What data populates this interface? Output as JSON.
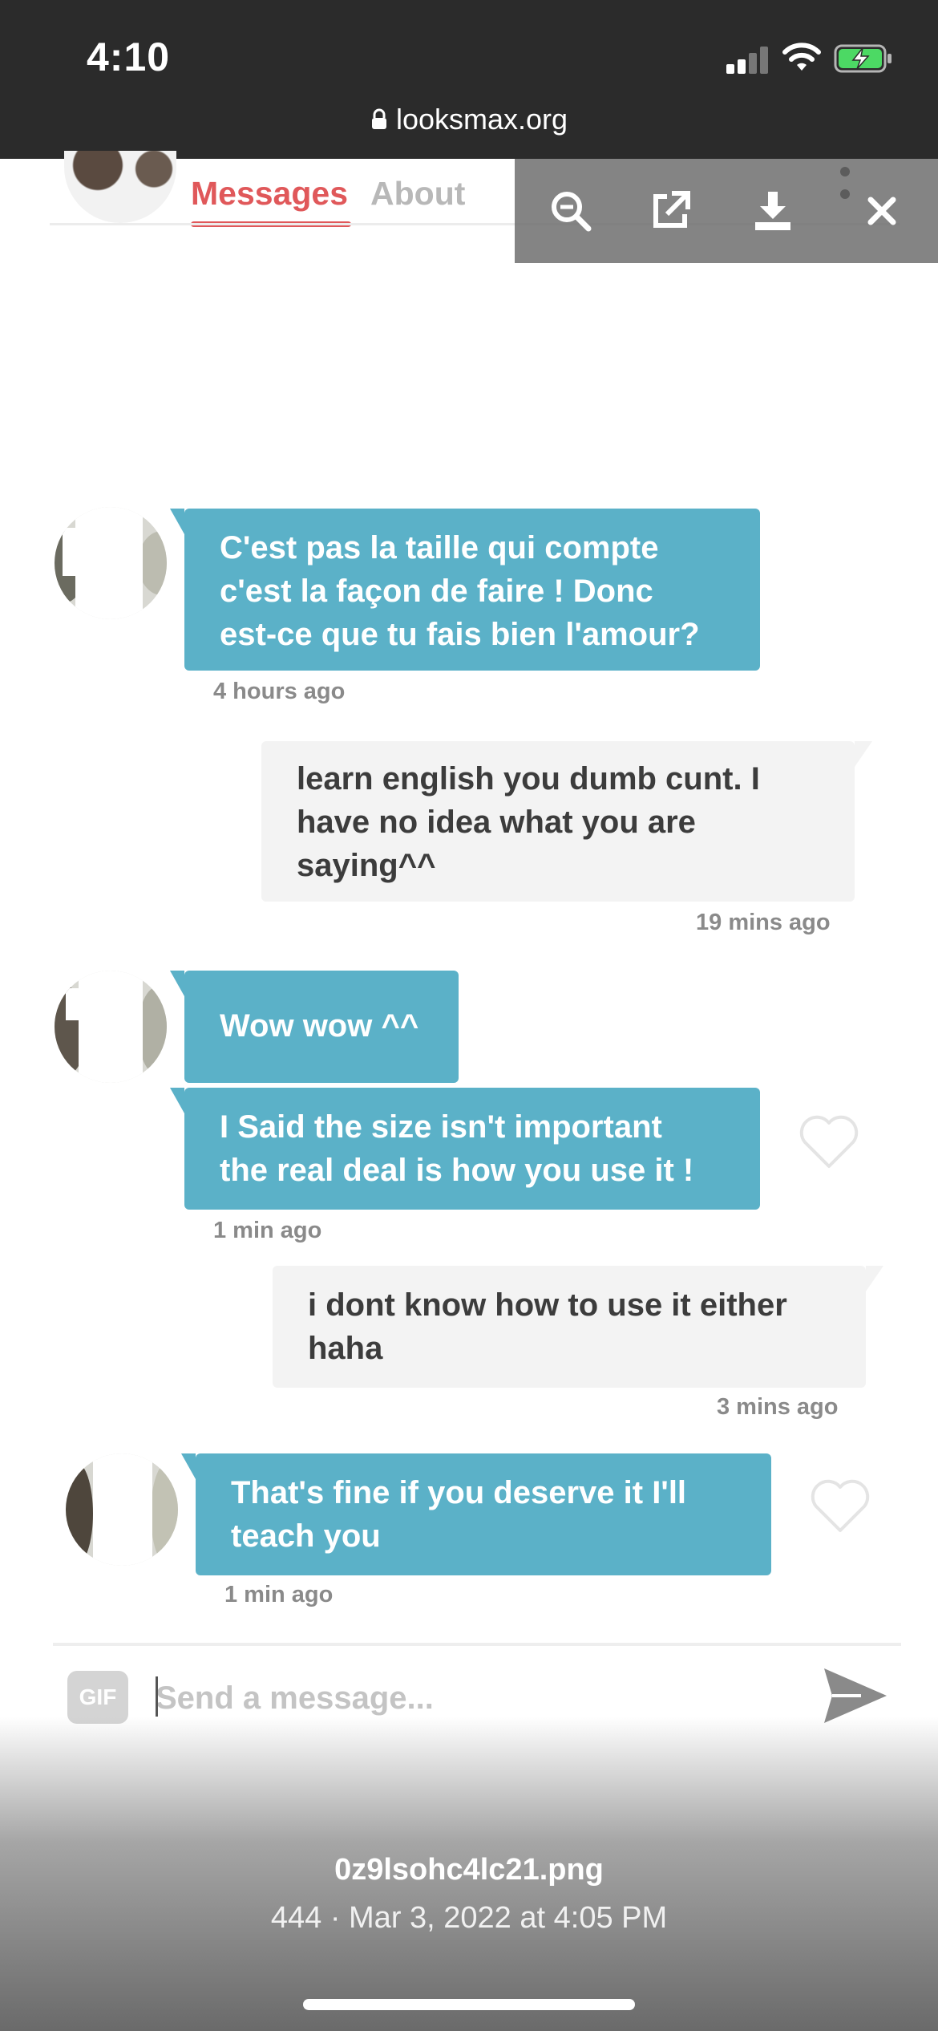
{
  "status_bar": {
    "time": "4:10",
    "icons": [
      "signal-icon",
      "wifi-icon",
      "battery-charging-icon"
    ],
    "battery_color": "#4cd964"
  },
  "browser": {
    "url": "looksmax.org",
    "lock_icon": "lock-icon"
  },
  "tabs": [
    {
      "label": "Messages",
      "active": true
    },
    {
      "label": "About",
      "active": false
    }
  ],
  "viewer_toolbar": {
    "buttons": [
      "zoom-out-icon",
      "open-external-icon",
      "download-icon",
      "close-icon"
    ]
  },
  "messages": [
    {
      "direction": "incoming",
      "lines": [
        "C'est pas la taille qui compte",
        "c'est la façon de faire ! Donc",
        "est-ce que tu fais bien l'amour?"
      ],
      "time": "4 hours ago"
    },
    {
      "direction": "outgoing",
      "lines": [
        "learn english you dumb cunt. I",
        "have no idea what you are",
        "saying^^"
      ],
      "time": "19 mins ago"
    },
    {
      "direction": "incoming",
      "lines": [
        "Wow wow ^^"
      ],
      "time": ""
    },
    {
      "direction": "incoming",
      "lines": [
        "I Said the size isn't important",
        "the real deal is how you use it !"
      ],
      "time": "1 min ago"
    },
    {
      "direction": "outgoing",
      "lines": [
        "i dont know how to use it either",
        "haha"
      ],
      "time": "3 mins ago"
    },
    {
      "direction": "incoming",
      "lines": [
        "That's fine if you deserve it I'll",
        "teach you"
      ],
      "time": "1 min ago"
    }
  ],
  "composer": {
    "gif_label": "GIF",
    "placeholder": "Send a message...",
    "send_icon": "send-icon"
  },
  "viewer_caption": {
    "filename": "0z9lsohc4lc21.png",
    "info": "444 · Mar 3, 2022 at 4:05 PM"
  },
  "colors": {
    "accent": "#e0585a",
    "incoming_bubble": "#5bb1c8",
    "outgoing_bubble": "#f3f3f3"
  }
}
